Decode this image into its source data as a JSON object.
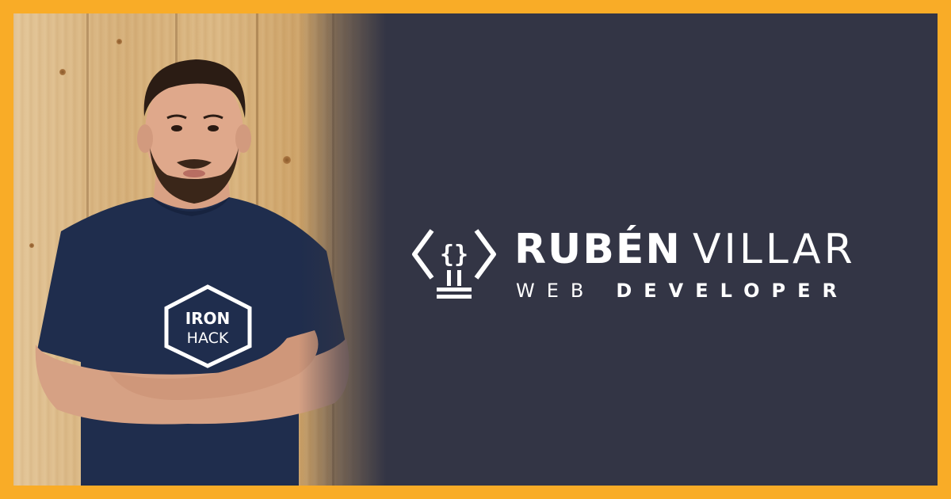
{
  "brand": {
    "first_name": "RUBÉN",
    "last_name": "VILLAR",
    "tagline_part1": "WEB",
    "tagline_part2": "DEVELOPER",
    "icon": "code-bulb-icon",
    "shirt_logo_line1": "IRON",
    "shirt_logo_line2": "HACK"
  },
  "colors": {
    "border": "#f9ac27",
    "panel": "#333545",
    "text": "#ffffff",
    "shirt": "#1f2d4d"
  }
}
